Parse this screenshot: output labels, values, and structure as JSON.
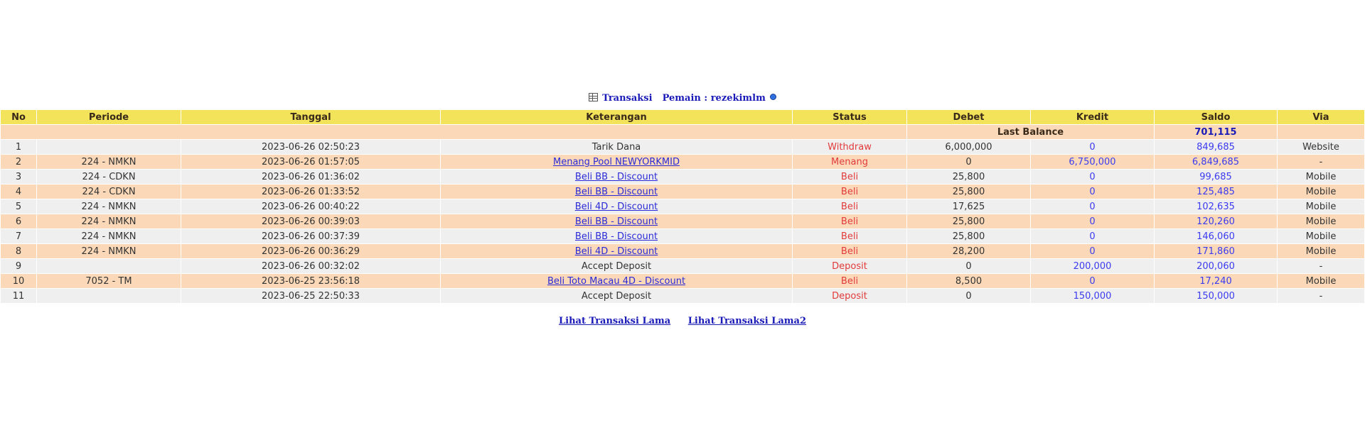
{
  "header": {
    "title": "Transaksi",
    "player_label": "Pemain : rezekimlm"
  },
  "columns": [
    "No",
    "Periode",
    "Tanggal",
    "Keterangan",
    "Status",
    "Debet",
    "Kredit",
    "Saldo",
    "Via"
  ],
  "last_balance": {
    "label": "Last Balance",
    "value": "701,115"
  },
  "rows": [
    {
      "no": "1",
      "periode": "",
      "tanggal": "2023-06-26 02:50:23",
      "keterangan": "Tarik Dana",
      "link": false,
      "status": "Withdraw",
      "debet": "6,000,000",
      "kredit": "0",
      "saldo": "849,685",
      "via": "Website"
    },
    {
      "no": "2",
      "periode": "224 - NMKN",
      "tanggal": "2023-06-26 01:57:05",
      "keterangan": "Menang Pool NEWYORKMID",
      "link": true,
      "status": "Menang",
      "debet": "0",
      "kredit": "6,750,000",
      "saldo": "6,849,685",
      "via": "-"
    },
    {
      "no": "3",
      "periode": "224 - CDKN",
      "tanggal": "2023-06-26 01:36:02",
      "keterangan": "Beli BB - Discount",
      "link": true,
      "status": "Beli",
      "debet": "25,800",
      "kredit": "0",
      "saldo": "99,685",
      "via": "Mobile"
    },
    {
      "no": "4",
      "periode": "224 - CDKN",
      "tanggal": "2023-06-26 01:33:52",
      "keterangan": "Beli BB - Discount",
      "link": true,
      "status": "Beli",
      "debet": "25,800",
      "kredit": "0",
      "saldo": "125,485",
      "via": "Mobile"
    },
    {
      "no": "5",
      "periode": "224 - NMKN",
      "tanggal": "2023-06-26 00:40:22",
      "keterangan": "Beli 4D - Discount",
      "link": true,
      "status": "Beli",
      "debet": "17,625",
      "kredit": "0",
      "saldo": "102,635",
      "via": "Mobile"
    },
    {
      "no": "6",
      "periode": "224 - NMKN",
      "tanggal": "2023-06-26 00:39:03",
      "keterangan": "Beli BB - Discount",
      "link": true,
      "status": "Beli",
      "debet": "25,800",
      "kredit": "0",
      "saldo": "120,260",
      "via": "Mobile"
    },
    {
      "no": "7",
      "periode": "224 - NMKN",
      "tanggal": "2023-06-26 00:37:39",
      "keterangan": "Beli BB - Discount",
      "link": true,
      "status": "Beli",
      "debet": "25,800",
      "kredit": "0",
      "saldo": "146,060",
      "via": "Mobile"
    },
    {
      "no": "8",
      "periode": "224 - NMKN",
      "tanggal": "2023-06-26 00:36:29",
      "keterangan": "Beli 4D - Discount",
      "link": true,
      "status": "Beli",
      "debet": "28,200",
      "kredit": "0",
      "saldo": "171,860",
      "via": "Mobile"
    },
    {
      "no": "9",
      "periode": "",
      "tanggal": "2023-06-26 00:32:02",
      "keterangan": "Accept Deposit",
      "link": false,
      "status": "Deposit",
      "debet": "0",
      "kredit": "200,000",
      "saldo": "200,060",
      "via": "-"
    },
    {
      "no": "10",
      "periode": "7052 - TM",
      "tanggal": "2023-06-25 23:56:18",
      "keterangan": "Beli Toto Macau 4D - Discount",
      "link": true,
      "status": "Beli",
      "debet": "8,500",
      "kredit": "0",
      "saldo": "17,240",
      "via": "Mobile"
    },
    {
      "no": "11",
      "periode": "",
      "tanggal": "2023-06-25 22:50:33",
      "keterangan": "Accept Deposit",
      "link": false,
      "status": "Deposit",
      "debet": "0",
      "kredit": "150,000",
      "saldo": "150,000",
      "via": "-"
    }
  ],
  "footer": {
    "link1": "Lihat Transaksi Lama",
    "link2": "Lihat Transaksi Lama2"
  },
  "colors": {
    "header_bg": "#f2e35a",
    "row_peach": "#fbd9b8",
    "row_gray": "#efefef",
    "status_red": "#e23a3a",
    "value_blue": "#3b3bf0",
    "link_blue": "#1a1ab8"
  },
  "icons": [
    "table-icon",
    "info-icon"
  ]
}
